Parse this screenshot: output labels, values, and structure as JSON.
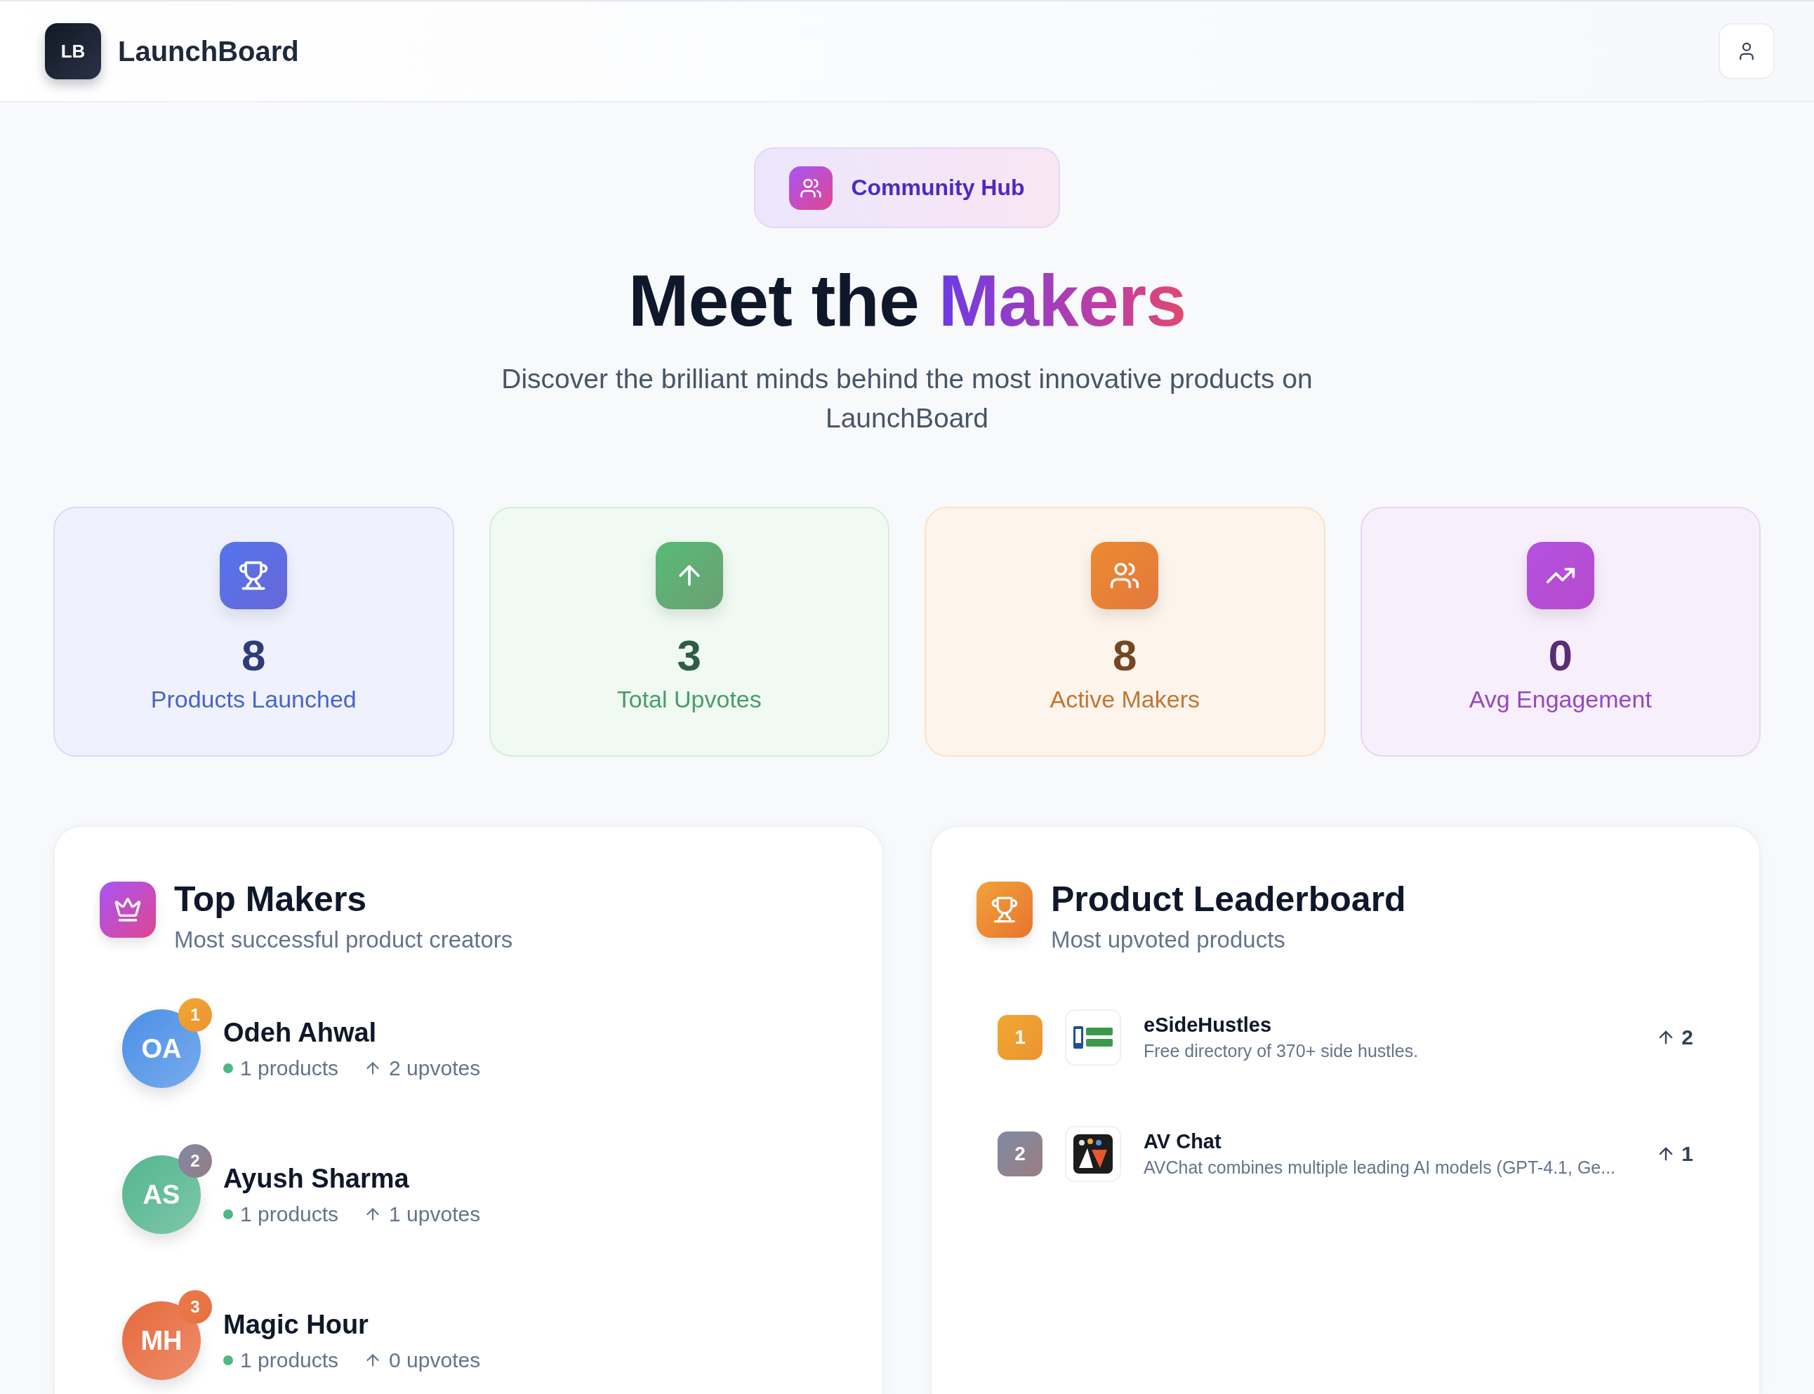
{
  "header": {
    "logo": "LB",
    "title": "LaunchBoard"
  },
  "hero": {
    "badge": "Community Hub",
    "title": "Meet the",
    "title_highlight": "Makers",
    "subtitle": "Discover the brilliant minds behind the most innovative products on LaunchBoard"
  },
  "stats": [
    {
      "value": "8",
      "label": "Products Launched",
      "color": "#5274ee"
    },
    {
      "value": "3",
      "label": "Total Upvotes",
      "color": "#55bb74"
    },
    {
      "value": "8",
      "label": "Active Makers",
      "color": "#ec8a2e"
    },
    {
      "value": "0",
      "label": "Avg Engagement",
      "color": "#b451e0"
    }
  ],
  "top_makers": {
    "title": "Top Makers",
    "subtitle": "Most successful product creators",
    "makers": [
      {
        "name": "Odeh Ahwal",
        "avatar": {
          "initials": "OA",
          "color": "#4b8fe6"
        },
        "rank": {
          "text": "1",
          "color": "#f0a832"
        },
        "products": "1 products",
        "upvotes": "2 upvotes"
      },
      {
        "name": "Ayush Sharma",
        "avatar": {
          "initials": "AS",
          "color": "#52b58e"
        },
        "rank": {
          "text": "2",
          "color": "#7d8aa3"
        },
        "products": "1 products",
        "upvotes": "1 upvotes"
      },
      {
        "name": "Magic Hour",
        "avatar": {
          "initials": "MH",
          "color": "#e6683a"
        },
        "rank": {
          "text": "3",
          "color": "#ea7a48"
        },
        "products": "1 products",
        "upvotes": "0 upvotes"
      }
    ]
  },
  "leaderboard": {
    "title": "Product Leaderboard",
    "subtitle": "Most upvoted products",
    "products": [
      {
        "rank": {
          "text": "1",
          "color": "#f0a832"
        },
        "name": "eSideHustles",
        "description": "Free directory of 370+ side hustles.",
        "votes": "2"
      },
      {
        "rank": {
          "text": "2",
          "color": "#7d8aa3"
        },
        "name": "AV Chat",
        "description": "AVChat combines multiple leading AI models (GPT-4.1, Ge...",
        "votes": "1"
      }
    ]
  }
}
